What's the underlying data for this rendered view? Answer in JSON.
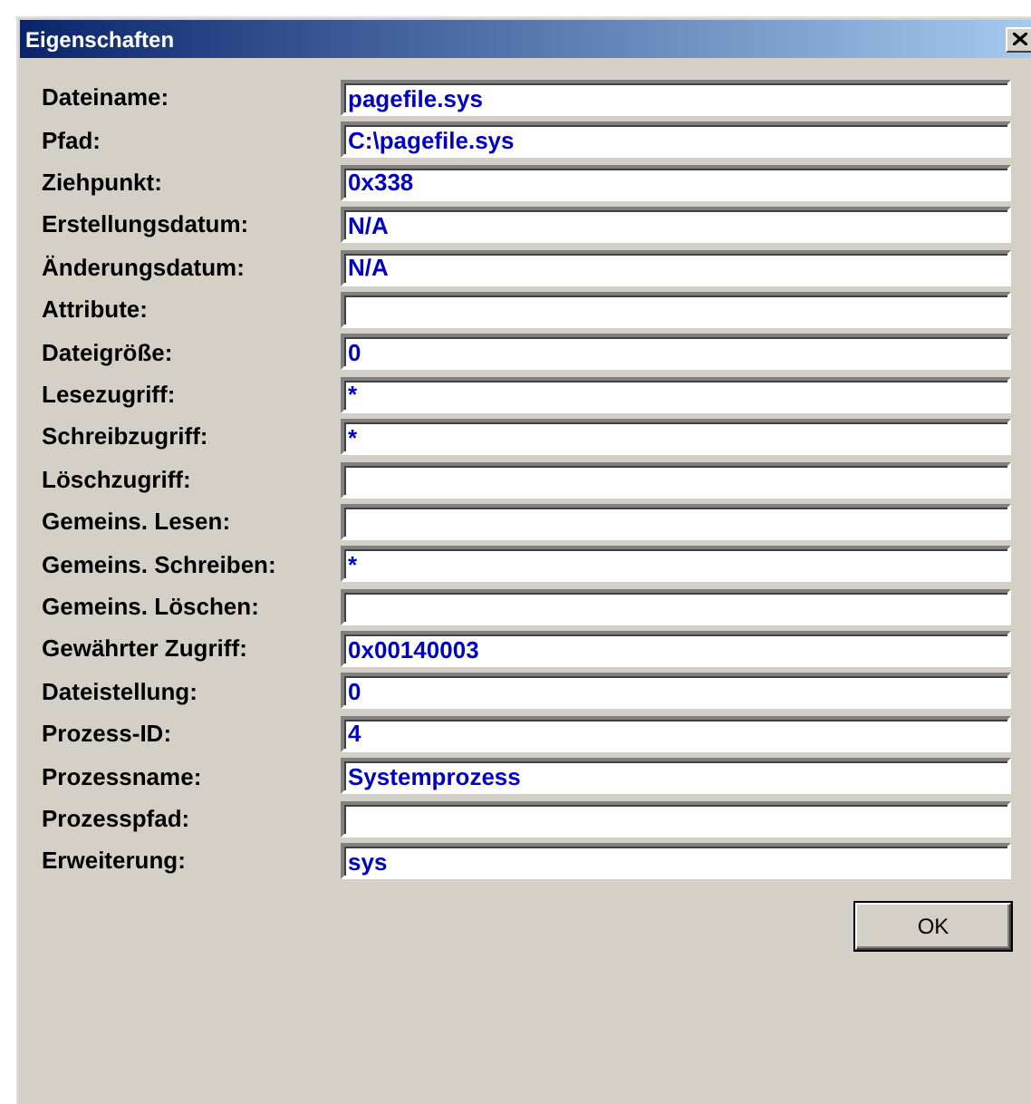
{
  "window": {
    "title": "Eigenschaften"
  },
  "fields": [
    {
      "label": "Dateiname:",
      "value": "pagefile.sys"
    },
    {
      "label": "Pfad:",
      "value": "C:\\pagefile.sys"
    },
    {
      "label": "Ziehpunkt:",
      "value": "0x338"
    },
    {
      "label": "Erstellungsdatum:",
      "value": "N/A"
    },
    {
      "label": "Änderungsdatum:",
      "value": "N/A"
    },
    {
      "label": "Attribute:"
    },
    {
      "label": "Dateigröße:",
      "value": "0"
    },
    {
      "label": "Lesezugriff:",
      "value": "*"
    },
    {
      "label": "Schreibzugriff:",
      "value": "*"
    },
    {
      "label": "Löschzugriff:"
    },
    {
      "label": "Gemeins. Lesen:"
    },
    {
      "label": "Gemeins. Schreiben:",
      "value": "*"
    },
    {
      "label": "Gemeins. Löschen:"
    },
    {
      "label": "Gewährter Zugriff:",
      "value": "0x00140003"
    },
    {
      "label": "Dateistellung:",
      "value": "0"
    },
    {
      "label": "Prozess-ID:",
      "value": "4"
    },
    {
      "label": "Prozessname:",
      "value": "Systemprozess"
    },
    {
      "label": "Prozesspfad:"
    },
    {
      "label": "Erweiterung:",
      "value": "sys"
    }
  ],
  "buttons": [
    "OK"
  ]
}
